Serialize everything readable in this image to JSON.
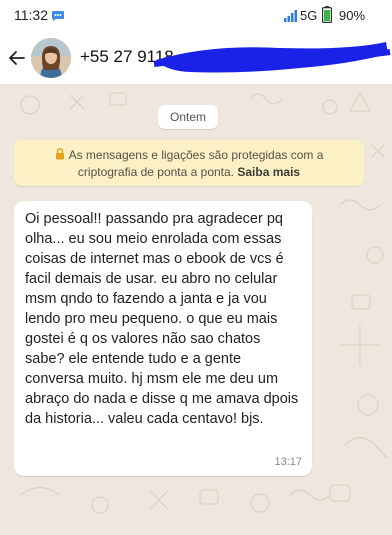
{
  "status_bar": {
    "time": "11:32",
    "network": "5G",
    "battery": "90%",
    "icons": [
      "message-notification-icon",
      "signal-icon",
      "battery-icon"
    ]
  },
  "header": {
    "contact_number": "+55 27 9118",
    "icons": [
      "back-arrow-icon",
      "avatar"
    ]
  },
  "chat": {
    "date_chip": "Ontem",
    "encryption": {
      "line1": "As mensagens e ligações são protegidas com a",
      "line2": "criptografia de ponta a ponta.",
      "link": "Saiba mais",
      "icon": "lock-icon"
    },
    "messages": [
      {
        "direction": "incoming",
        "text": "Oi pessoal!! passando pra agradecer pq olha... eu sou meio enrolada com essas coisas de internet mas o ebook de vcs é facil demais de usar. eu abro no celular msm qndo to fazendo a janta e ja vou lendo pro meu pequeno. o que eu mais gostei é q os valores não sao chatos sabe? ele entende tudo e a gente conversa muito. hj msm ele me deu um abraço do nada e disse q me amava dpois da historia... valeu cada centavo! bjs.",
        "time": "13:17"
      }
    ]
  },
  "colors": {
    "chat_background": "#efe7de",
    "encryption_banner": "#fcf1c4",
    "bubble": "#ffffff",
    "redaction": "#1a22e8"
  }
}
